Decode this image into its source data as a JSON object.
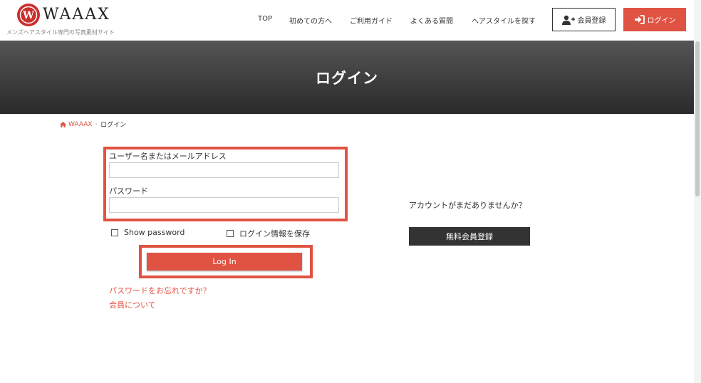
{
  "header": {
    "logo_text": "WAAAX",
    "logo_seal_letter": "W",
    "tagline": "メンズヘアスタイル専門の写真素材サイト",
    "nav": [
      "TOP",
      "初めての方へ",
      "ご利用ガイド",
      "よくある質問",
      "ヘアスタイルを探す"
    ],
    "register_label": "会員登録",
    "login_label": "ログイン"
  },
  "banner": {
    "title": "ログイン"
  },
  "breadcrumb": {
    "home": "WAAAX",
    "separator": "›",
    "current": "ログイン"
  },
  "form": {
    "username_label": "ユーザー名またはメールアドレス",
    "username_value": "",
    "password_label": "パスワード",
    "password_value": "",
    "show_password_label": "Show password",
    "remember_label": "ログイン情報を保存",
    "submit_label": "Log In",
    "forgot_link": "パスワードをお忘れですか？",
    "about_link": "会員について"
  },
  "side": {
    "no_account_text": "アカウントがまだありませんか？",
    "free_register_label": "無料会員登録"
  },
  "colors": {
    "accent": "#e05343",
    "dark": "#333333",
    "banner_top": "#555555",
    "banner_bottom": "#2a2a2a"
  }
}
